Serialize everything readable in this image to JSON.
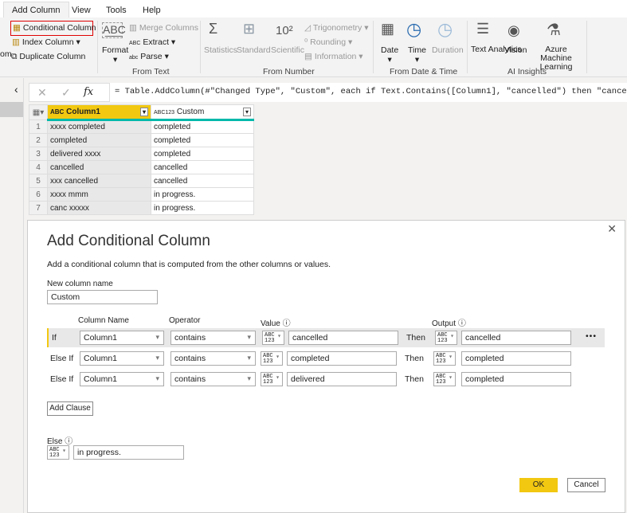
{
  "ribbon": {
    "tabs": [
      "Add Column",
      "View",
      "Tools",
      "Help"
    ],
    "general": {
      "partial": "om",
      "conditional": "Conditional Column",
      "index": "Index Column",
      "duplicate": "Duplicate Column"
    },
    "from_text": {
      "format": "Format",
      "merge": "Merge Columns",
      "extract": "Extract",
      "parse": "Parse",
      "group": "From Text"
    },
    "from_number": {
      "statistics": "Statistics",
      "standard": "Standard",
      "scientific": "Scientific",
      "trig": "Trigonometry",
      "rounding": "Rounding",
      "information": "Information",
      "group": "From Number"
    },
    "from_date": {
      "date": "Date",
      "time": "Time",
      "duration": "Duration",
      "group": "From Date & Time"
    },
    "ai": {
      "text_analytics": "Text Analytics",
      "vision": "Vision",
      "azure": "Azure Machine Learning",
      "group": "AI Insights"
    }
  },
  "formula": "= Table.AddColumn(#\"Changed Type\", \"Custom\", each if Text.Contains([Column1], \"cancelled\") then \"cancelled\" else if Text.C",
  "table": {
    "headers": [
      "Column1",
      "Custom"
    ],
    "rows": [
      [
        "1",
        "xxxx completed",
        "completed"
      ],
      [
        "2",
        "completed",
        "completed"
      ],
      [
        "3",
        "delivered xxxx",
        "completed"
      ],
      [
        "4",
        "cancelled",
        "cancelled"
      ],
      [
        "5",
        "xxx cancelled",
        "cancelled"
      ],
      [
        "6",
        "xxxx mmm",
        "in progress."
      ],
      [
        "7",
        "canc xxxxx",
        "in progress."
      ]
    ]
  },
  "dialog": {
    "title": "Add Conditional Column",
    "subtitle": "Add a conditional column that is computed from the other columns or values.",
    "new_col_label": "New column name",
    "new_col_value": "Custom",
    "headers": {
      "column": "Column Name",
      "operator": "Operator",
      "value": "Value",
      "output": "Output"
    },
    "type_label": "ABC 123",
    "then": "Then",
    "clauses": [
      {
        "kind": "If",
        "column": "Column1",
        "operator": "contains",
        "value": "cancelled",
        "output": "cancelled"
      },
      {
        "kind": "Else If",
        "column": "Column1",
        "operator": "contains",
        "value": "completed",
        "output": "completed"
      },
      {
        "kind": "Else If",
        "column": "Column1",
        "operator": "contains",
        "value": "delivered",
        "output": "completed"
      }
    ],
    "add_clause": "Add Clause",
    "else_label": "Else",
    "else_value": "in progress.",
    "ok": "OK",
    "cancel": "Cancel"
  },
  "colors": {
    "accent": "#f2c811",
    "teal": "#01b8aa",
    "highlight_red": "#e00000"
  }
}
